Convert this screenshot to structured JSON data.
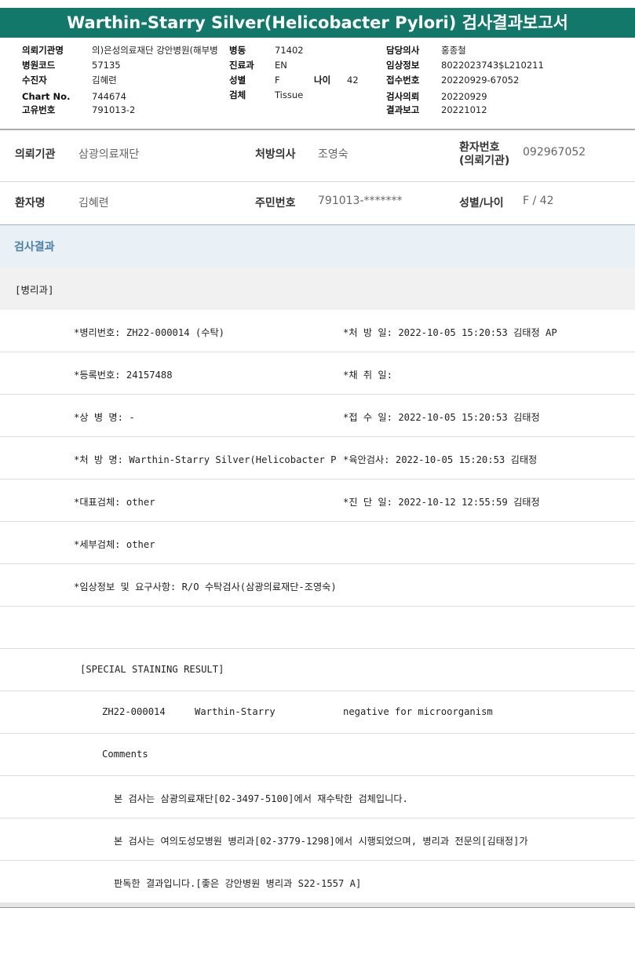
{
  "title": "Warthin-Starry Silver(Helicobacter Pylori) 검사결과보고서",
  "header": {
    "req_org_label": "의뢰기관명",
    "req_org_value": "의)은성의료재단 강안병원(해부병",
    "ward_label": "병동",
    "ward_value": "71402",
    "doctor_label": "담당의사",
    "doctor_value": "홍종철",
    "hosp_code_label": "병원코드",
    "hosp_code_value": "57135",
    "dept_label": "진료과",
    "dept_value": "EN",
    "clinical_label": "임상정보",
    "clinical_value": "8022023743$L210211",
    "patient_label": "수진자",
    "patient_value": "김혜련",
    "sex_label": "성별",
    "sex_value": "F",
    "age_label": "나이",
    "age_value": "42",
    "receipt_label": "접수번호",
    "receipt_value": "20220929-67052",
    "chart_label": "Chart No.",
    "chart_value": "744674",
    "specimen_label": "검체",
    "specimen_value": "Tissue",
    "request_label": "검사의뢰",
    "request_value": "20220929",
    "unique_label": "고유번호",
    "unique_value": "791013-2",
    "report_label": "결과보고",
    "report_value": "20221012"
  },
  "info": {
    "org_label": "의뢰기관",
    "org_value": "삼광의료재단",
    "physician_label": "처방의사",
    "physician_value": "조영숙",
    "patno_label_1": "환자번호",
    "patno_label_2": "(의뢰기관)",
    "patno_value": "092967052",
    "name_label": "환자명",
    "name_value": "김혜련",
    "rrn_label": "주민번호",
    "rrn_value": "791013-*******",
    "sexage_label": "성별/나이",
    "sexage_value": "F / 42"
  },
  "results": {
    "section_title": "검사결과",
    "department": "[병리과]",
    "lines": {
      "path_no": "*병리번호: ZH22-000014 (수탁)",
      "prescribe_date": "*처 방 일: 2022-10-05 15:20:53  김태정 AP",
      "reg_no": "*등록번호: 24157488",
      "collect_date": "*채 취 일:",
      "disease": "*상 병 명: -",
      "receipt_date": "*접 수 일: 2022-10-05 15:20:53  김태정",
      "order_name": "*처 방 명: Warthin-Starry Silver(Helicobacter P",
      "gross_exam": "*육안검사: 2022-10-05 15:20:53  김태정",
      "main_specimen": "*대표검체: other",
      "diag_date": "*진 단 일: 2022-10-12 12:55:59  김태정",
      "sub_specimen": "*세부검체: other",
      "clinical_req": "*임상정보 및 요구사항: R/O 수탁검사(삼광의료재단-조영숙)",
      "special_header": "[SPECIAL STAINING RESULT]",
      "stain_id": "ZH22-000014",
      "stain_name": "Warthin-Starry",
      "stain_result": "negative for microorganism",
      "comments": "Comments",
      "comment_1": "본 검사는 삼광의료재단[02-3497-5100]에서 재수탁한 검체입니다.",
      "comment_2": "본 검사는 여의도성모병원 병리과[02-3779-1298]에서 시행되었으며, 병리과 전문의[김태정]가",
      "comment_3": "판독한 결과입니다.[좋은 강안병원 병리과 S22-1557 A]"
    }
  }
}
